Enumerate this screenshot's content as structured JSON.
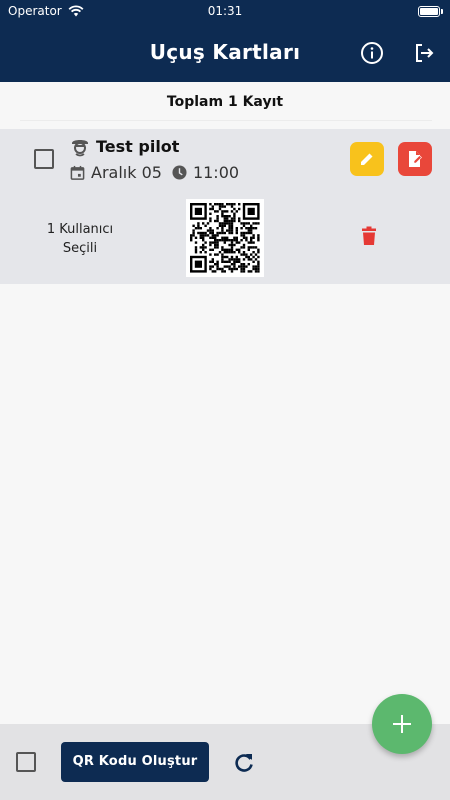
{
  "status_bar": {
    "carrier": "Operator",
    "time": "01:31"
  },
  "header": {
    "title": "Uçuş Kartları",
    "info_icon": "info-icon",
    "logout_icon": "logout-icon"
  },
  "list": {
    "total_label": "Toplam 1 Kayıt"
  },
  "cards": [
    {
      "name": "Test pilot",
      "date": "Aralık 05",
      "time": "11:00",
      "selected_users_line1": "1 Kullanıcı",
      "selected_users_line2": "Seçili",
      "icons": {
        "pilot": "pilot-icon",
        "calendar": "calendar-icon",
        "clock": "clock-icon",
        "edit": "pencil-icon",
        "document": "document-edit-icon",
        "trash": "trash-icon"
      }
    }
  ],
  "footer": {
    "qr_button_label": "QR Kodu Oluştur",
    "refresh_icon": "refresh-icon"
  },
  "fab": {
    "icon": "plus-icon"
  },
  "colors": {
    "primary": "#0d2b52",
    "card_bg": "#e5e6ea",
    "edit_yellow": "#f8c21c",
    "doc_red": "#e9473a",
    "trash_red": "#e53935",
    "fab_green": "#5cb86e"
  }
}
